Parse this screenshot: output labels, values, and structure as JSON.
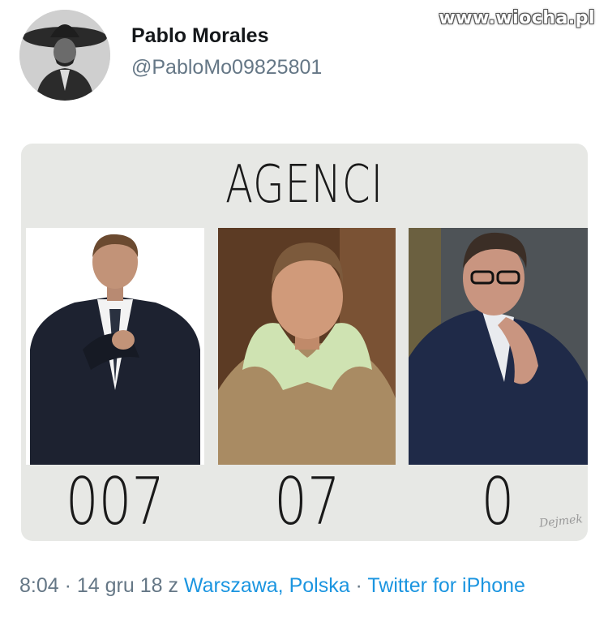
{
  "watermark": "www.wiocha.pl",
  "author": {
    "display_name": "Pablo Morales",
    "handle": "@PabloMo09825801"
  },
  "meme": {
    "title": "AGENCI",
    "codes": [
      "007",
      "07",
      "0"
    ],
    "signature": "Dejmek"
  },
  "meta": {
    "time": "8:04",
    "separator": " · ",
    "date_prefix": "14 gru 18 z ",
    "location": "Warszawa, Polska",
    "source": "Twitter for iPhone"
  },
  "colors": {
    "link": "#1b95e0",
    "secondary_text": "#657786",
    "primary_text": "#14171a"
  }
}
